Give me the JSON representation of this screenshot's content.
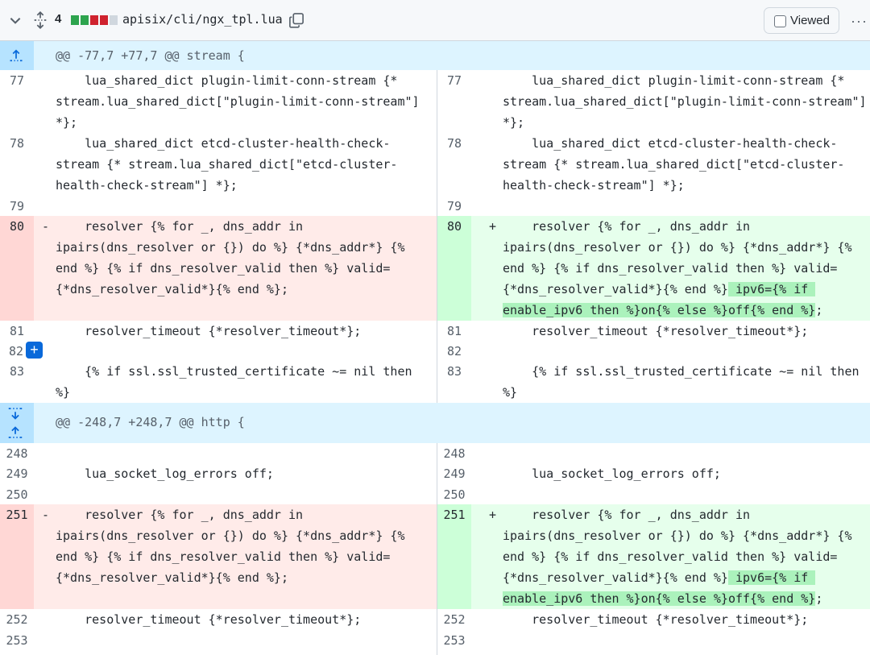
{
  "file": {
    "changes": "4",
    "path": "apisix/cli/ngx_tpl.lua",
    "viewed_label": "Viewed",
    "more": "···",
    "diffstat_colors": [
      "#2da44e",
      "#2da44e",
      "#cf222e",
      "#cf222e",
      "#d0d7de"
    ]
  },
  "hunks": [
    {
      "header": "@@ -77,7 +77,7 @@ stream {"
    },
    {
      "header": "@@ -248,7 +248,7 @@ http {"
    }
  ],
  "rows": {
    "r77": {
      "ln": "77",
      "rn": "77",
      "l1": "    lua_shared_dict plugin-limit-conn-stream {*",
      "l2": "stream.lua_shared_dict[\"plugin-limit-conn-stream\"]",
      "l3": "*};"
    },
    "r78": {
      "ln": "78",
      "rn": "78",
      "l1": "    lua_shared_dict etcd-cluster-health-check-",
      "l2": "stream {* stream.lua_shared_dict[\"etcd-cluster-",
      "l3": "health-check-stream\"] *};"
    },
    "r79": {
      "ln": "79",
      "rn": "79"
    },
    "r80": {
      "ln": "80",
      "rn": "80",
      "minus": "-",
      "plus": "+",
      "l1": "    resolver {% for _, dns_addr in",
      "l2": "ipairs(dns_resolver or {}) do %} {*dns_addr*} {%",
      "l3": "end %} {% if dns_resolver_valid then %} valid=",
      "l4": "{*dns_resolver_valid*}{% end %};",
      "r4a": "{*dns_resolver_valid*}{% end %}",
      "r4b": " ipv6={% if ",
      "r5a": "enable_ipv6 then %}on{% else %}off{% end %}",
      "r5b": ";"
    },
    "r81": {
      "ln": "81",
      "rn": "81",
      "l1": "    resolver_timeout {*resolver_timeout*};"
    },
    "r82": {
      "ln": "82",
      "rn": "82"
    },
    "r83": {
      "ln": "83",
      "rn": "83",
      "l1": "    {% if ssl.ssl_trusted_certificate ~= nil then",
      "l2": "%}"
    },
    "r248": {
      "ln": "248",
      "rn": "248"
    },
    "r249": {
      "ln": "249",
      "rn": "249",
      "l1": "    lua_socket_log_errors off;"
    },
    "r250": {
      "ln": "250",
      "rn": "250"
    },
    "r251": {
      "ln": "251",
      "rn": "251"
    },
    "r252": {
      "ln": "252",
      "rn": "252",
      "l1": "    resolver_timeout {*resolver_timeout*};"
    },
    "r253": {
      "ln": "253",
      "rn": "253"
    }
  },
  "add_button": "+"
}
